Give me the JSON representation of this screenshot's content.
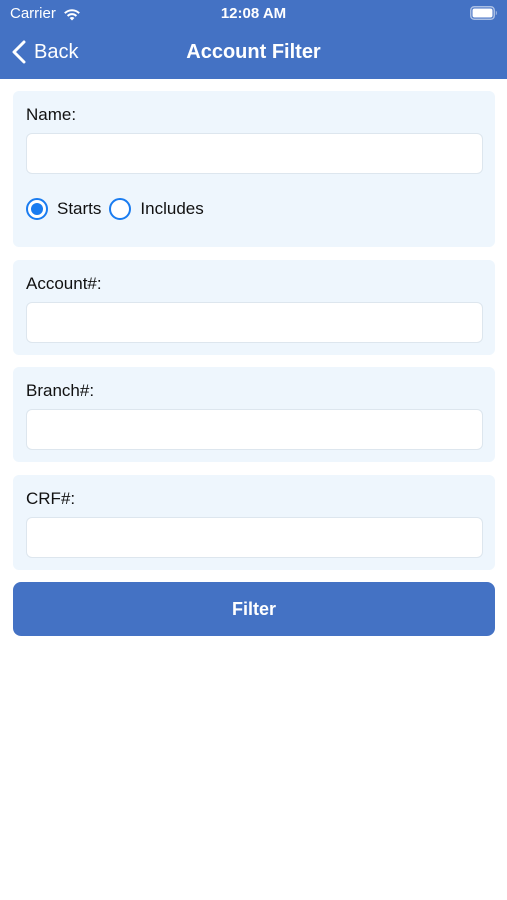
{
  "status_bar": {
    "carrier": "Carrier",
    "time": "12:08 AM"
  },
  "nav": {
    "back_label": "Back",
    "title": "Account Filter"
  },
  "form": {
    "name": {
      "label": "Name:",
      "value": "",
      "placeholder": ""
    },
    "match_mode": {
      "options": [
        {
          "label": "Starts",
          "selected": true
        },
        {
          "label": "Includes",
          "selected": false
        }
      ]
    },
    "account": {
      "label": "Account#:",
      "value": "",
      "placeholder": ""
    },
    "branch": {
      "label": "Branch#:",
      "value": "",
      "placeholder": ""
    },
    "crf": {
      "label": "CRF#:",
      "value": "",
      "placeholder": ""
    }
  },
  "filter_button": {
    "label": "Filter"
  },
  "colors": {
    "header": "#4472c4",
    "card_background": "#eef6fd",
    "radio_accent": "#1a7cf0",
    "button": "#4472c4"
  },
  "icons": {
    "wifi": "wifi-icon",
    "battery": "battery-icon",
    "back": "chevron-left-icon",
    "radio_selected": "radio-selected-icon",
    "radio_unselected": "radio-unselected-icon"
  }
}
